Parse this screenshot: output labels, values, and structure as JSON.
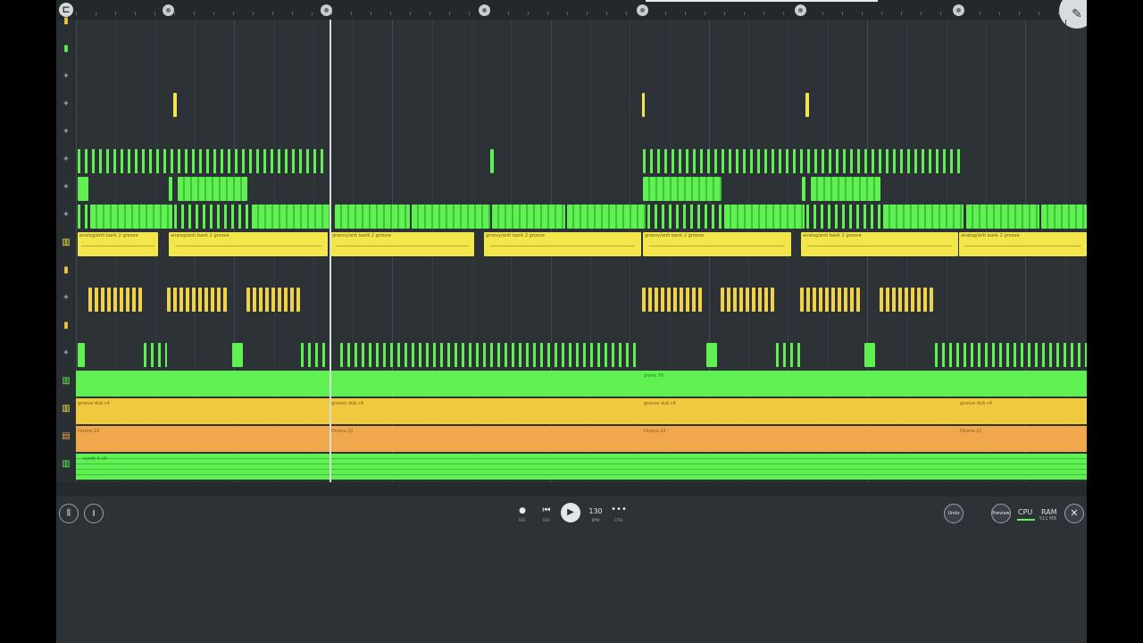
{
  "timeline": {
    "menu_icon": "dock-icon",
    "corner_icon": "cursor-icon"
  },
  "tracks": [
    {
      "type": "level"
    },
    {
      "type": "level"
    },
    {
      "type": "audio"
    },
    {
      "type": "audio"
    },
    {
      "type": "audio"
    },
    {
      "type": "audio"
    },
    {
      "type": "audio"
    },
    {
      "type": "audio"
    },
    {
      "type": "piano"
    },
    {
      "type": "level"
    },
    {
      "type": "audio"
    },
    {
      "type": "level"
    },
    {
      "type": "audio"
    },
    {
      "type": "piano"
    },
    {
      "type": "piano"
    },
    {
      "type": "drum"
    },
    {
      "type": "piano"
    }
  ],
  "clip_labels": {
    "yellow_1": "analog/anti bank 2 groove",
    "yellow_2": "analog/anti bank 2 groove",
    "yellow_3": "groovy/anti bank 2 groove",
    "yellow_4": "groovy/anti bank 2 groove",
    "yellow_5": "groovy/anti bank 2 groove",
    "yellow_6": "analog/anti bank 2 groove",
    "yellow_7": "analog/anti bank 2 groove",
    "green_row": "piano 78",
    "gold_1": "groove dub c4",
    "gold_2": "groove dub c4",
    "gold_3": "groove dub c4",
    "gold_4": "groove dub c4",
    "orange_1": "Drums 22",
    "orange_2": "Drums 22",
    "orange_3": "Drums 22",
    "orange_4": "Drums 22",
    "last_row": "synth 4 c4"
  },
  "transport": {
    "rec_label": "REC",
    "rew_label": "REV",
    "tempo": "130",
    "tempo_label": "BPM",
    "more_label": "CTRL",
    "undo": "Undo",
    "preview": "Preview",
    "cpu": "CPU",
    "ram": "RAM",
    "ram_value": "511 MB"
  },
  "colors": {
    "green": "#5ff152",
    "yellow": "#f3e64b",
    "gold": "#f1c93e",
    "orange": "#f1a74c",
    "background": "#2c3236"
  }
}
